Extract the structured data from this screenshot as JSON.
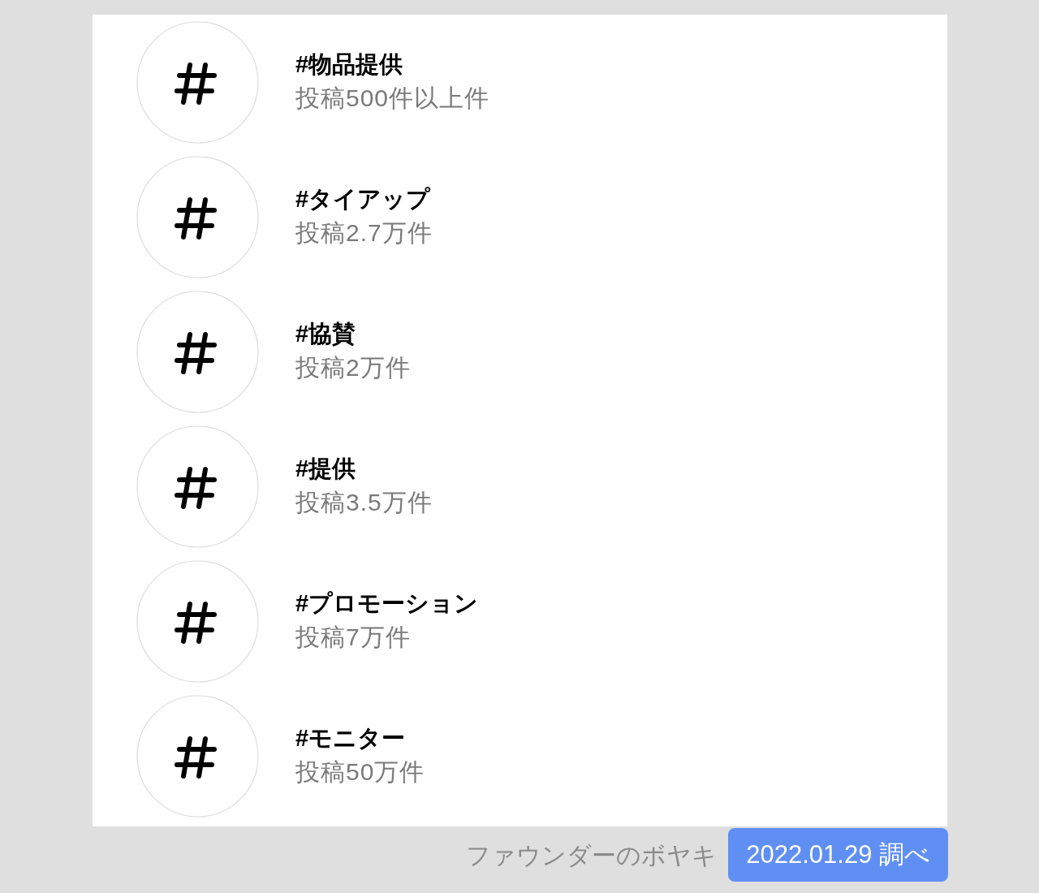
{
  "hashtags": [
    {
      "tag": "#物品提供",
      "posts": "投稿500件以上件"
    },
    {
      "tag": "#タイアップ",
      "posts": "投稿2.7万件"
    },
    {
      "tag": "#協賛",
      "posts": "投稿2万件"
    },
    {
      "tag": "#提供",
      "posts": "投稿3.5万件"
    },
    {
      "tag": "#プロモーション",
      "posts": "投稿7万件"
    },
    {
      "tag": "#モニター",
      "posts": "投稿50万件"
    }
  ],
  "footer": {
    "source": "ファウンダーのボヤキ",
    "date_badge": "2022.01.29 調べ"
  }
}
